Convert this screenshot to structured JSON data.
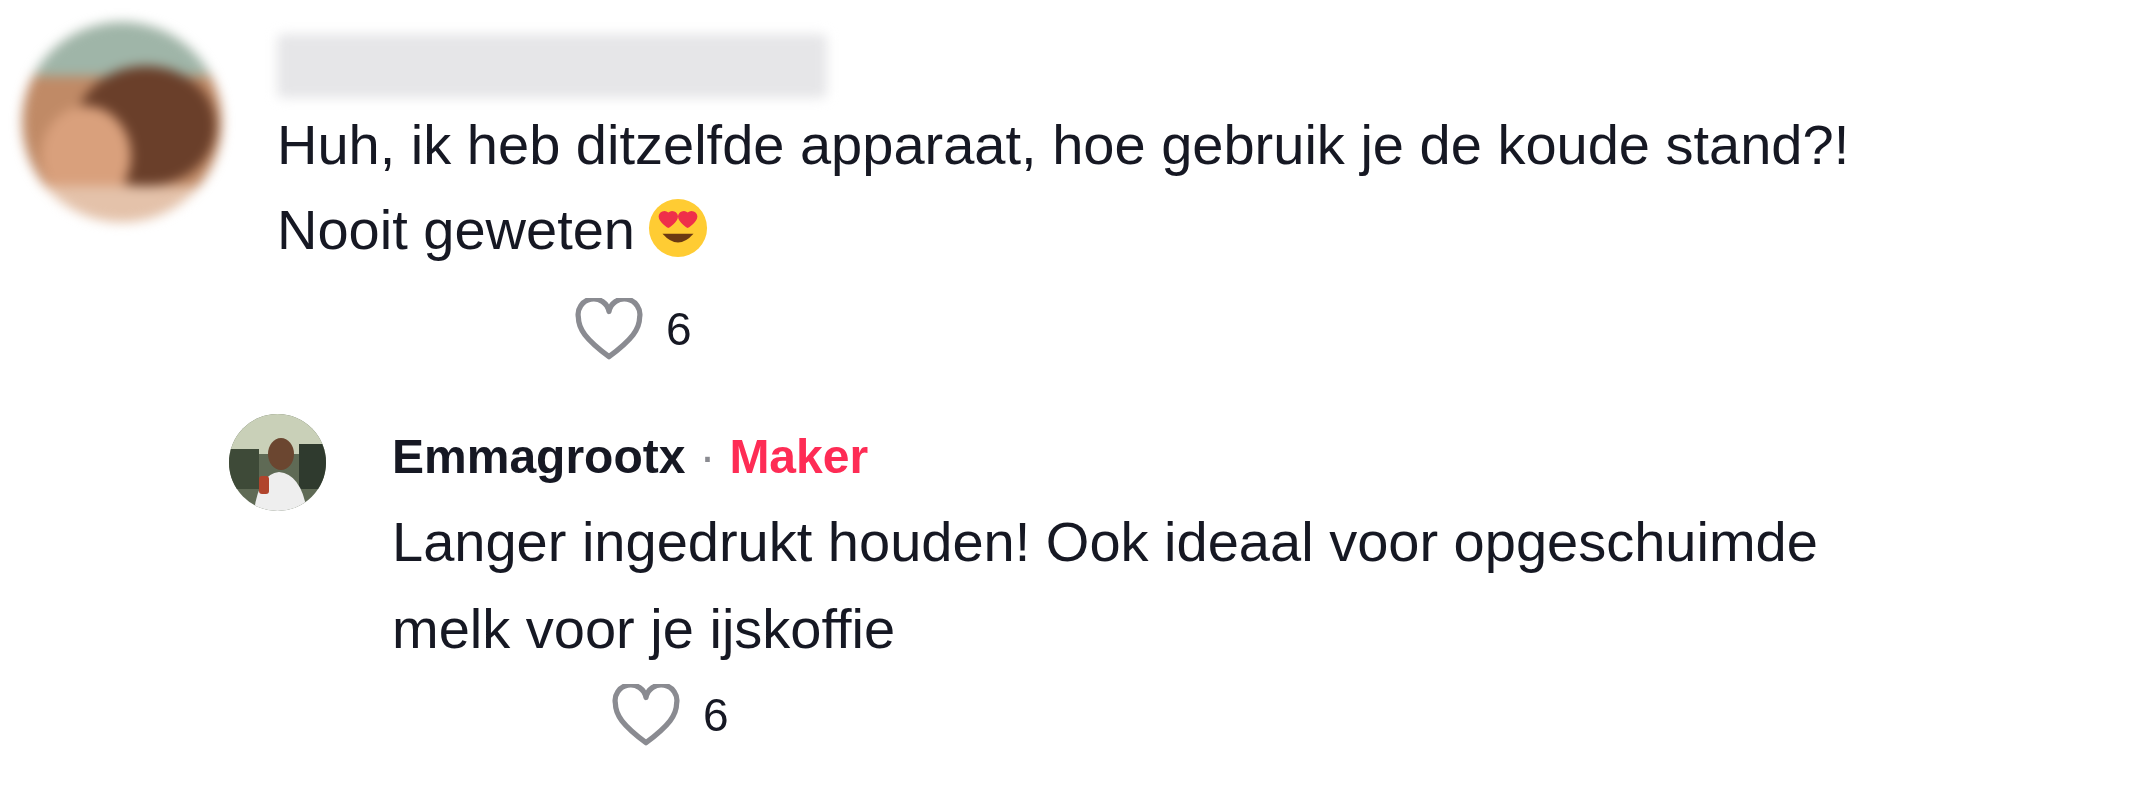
{
  "comment": {
    "text_lines": [
      "Huh, ik heb ditzelfde apparaat, hoe gebruik je de koude stand?!",
      "Nooit geweten"
    ],
    "likes": "6",
    "liked": false,
    "replies": [
      {
        "author": "Emmagrootx",
        "separator": "·",
        "badge": "Maker",
        "text": "Langer ingedrukt houden! Ook ideaal voor opgeschuimde melk voor je ijskoffie",
        "likes": "6",
        "liked": false
      }
    ]
  }
}
